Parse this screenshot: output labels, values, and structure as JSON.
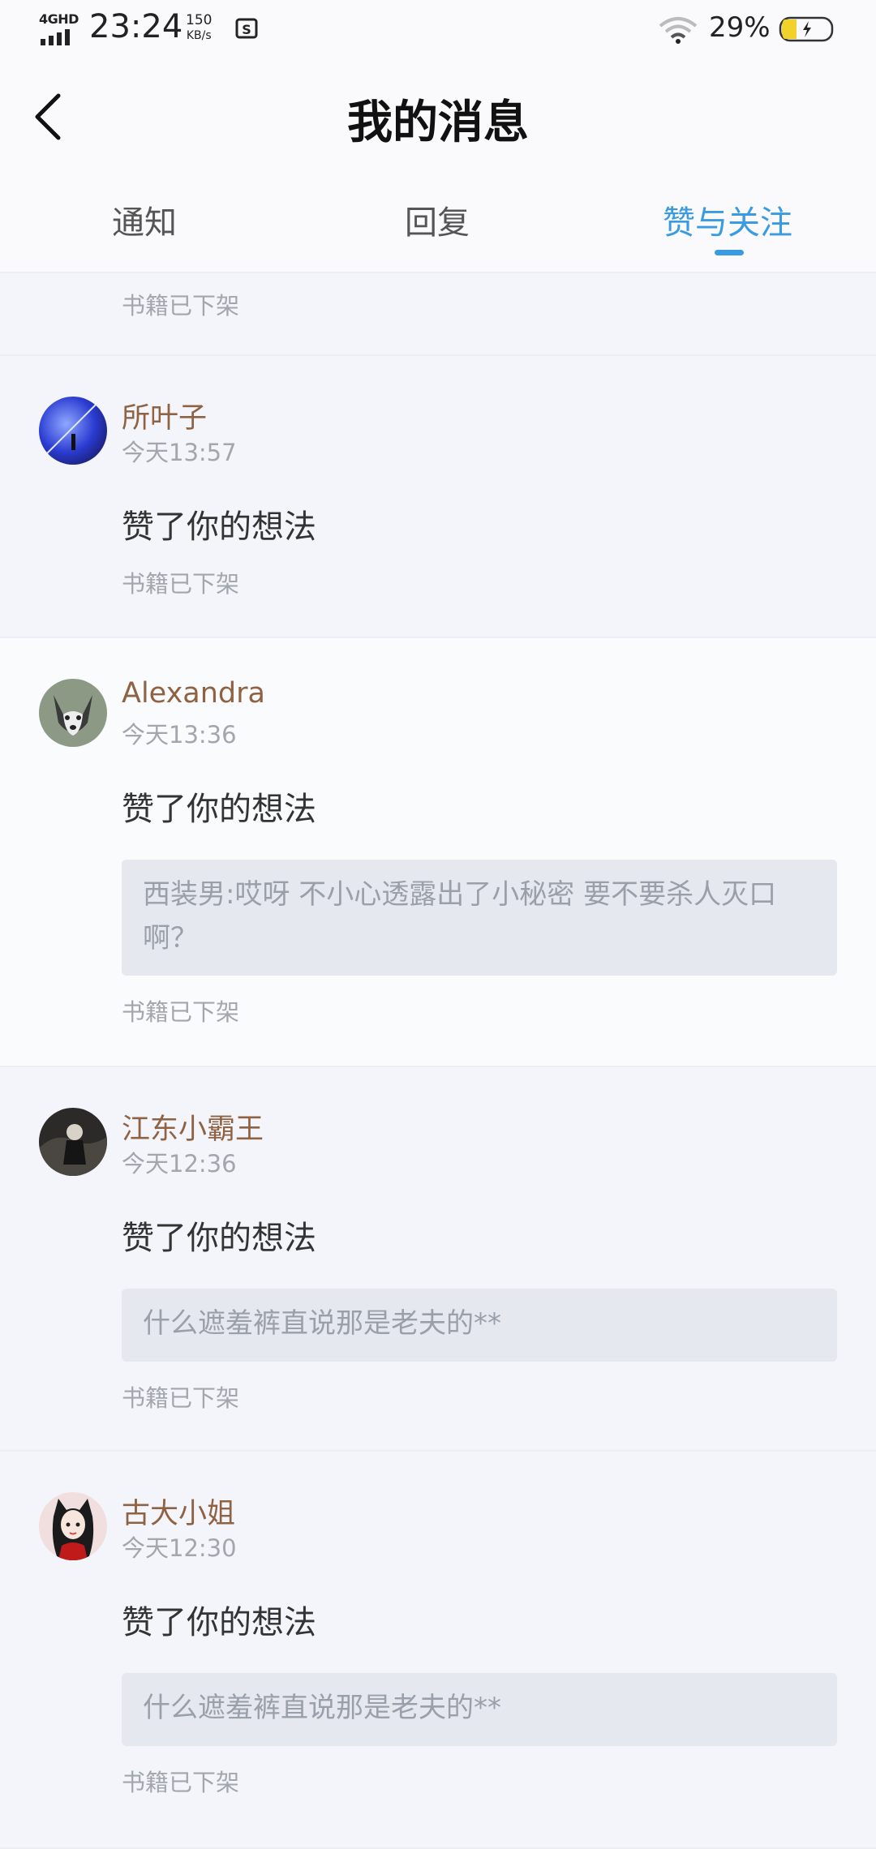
{
  "status_bar": {
    "network": "4GHD",
    "time": "23:24",
    "speed_value": "150",
    "speed_unit": "KB/s",
    "battery": "29%"
  },
  "header": {
    "title": "我的消息"
  },
  "tabs": [
    {
      "label": "通知",
      "active": false
    },
    {
      "label": "回复",
      "active": false
    },
    {
      "label": "赞与关注",
      "active": true
    }
  ],
  "colors": {
    "accent": "#3a9be0",
    "username": "#8f6244",
    "muted": "#a2a6ad"
  },
  "messages": [
    {
      "book_status": "书籍已下架"
    },
    {
      "username": "所叶子",
      "time": "今天13:57",
      "action": "赞了你的想法",
      "book_status": "书籍已下架"
    },
    {
      "username": "Alexandra",
      "time": "今天13:36",
      "action": "赞了你的想法",
      "quote": "西装男:哎呀 不小心透露出了小秘密  要不要杀人灭口啊？",
      "book_status": "书籍已下架"
    },
    {
      "username": "江东小霸王",
      "time": "今天12:36",
      "action": "赞了你的想法",
      "quote": "什么遮羞裤直说那是老夫的**",
      "book_status": "书籍已下架"
    },
    {
      "username": "古大小姐",
      "time": "今天12:30",
      "action": "赞了你的想法",
      "quote": "什么遮羞裤直说那是老夫的**",
      "book_status": "书籍已下架"
    }
  ]
}
